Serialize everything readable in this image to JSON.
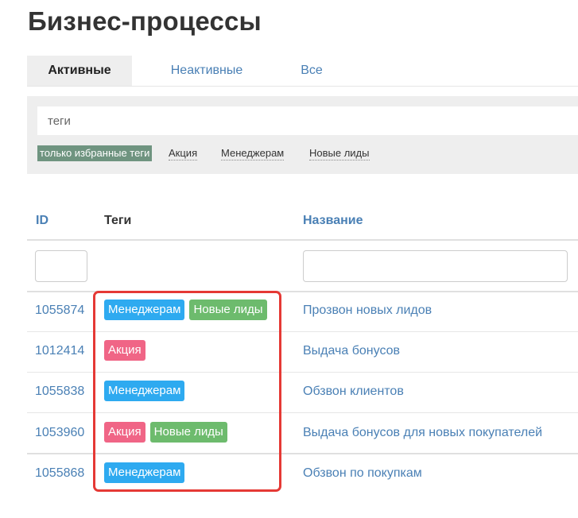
{
  "page": {
    "title": "Бизнес-процессы"
  },
  "tabs": [
    {
      "label": "Активные",
      "active": true
    },
    {
      "label": "Неактивные",
      "active": false
    },
    {
      "label": "Все",
      "active": false
    }
  ],
  "filter": {
    "tags_placeholder": "теги",
    "favorites_only_label": "только избранные теги",
    "quick_tags": [
      "Акция",
      "Менеджерам",
      "Новые лиды"
    ]
  },
  "table": {
    "headers": {
      "id": "ID",
      "tags": "Теги",
      "name": "Название"
    },
    "rows": [
      {
        "id": "1055874",
        "tags": [
          "Менеджерам",
          "Новые лиды"
        ],
        "name": "Прозвон новых лидов"
      },
      {
        "id": "1012414",
        "tags": [
          "Акция"
        ],
        "name": "Выдача бонусов"
      },
      {
        "id": "1055838",
        "tags": [
          "Менеджерам"
        ],
        "name": "Обзвон клиентов"
      },
      {
        "id": "1053960",
        "tags": [
          "Акция",
          "Новые лиды"
        ],
        "name": "Выдача бонусов для новых покупателей"
      },
      {
        "id": "1055868",
        "tags": [
          "Менеджерам"
        ],
        "name": "Обзвон по покупкам"
      }
    ]
  },
  "tag_colors": {
    "Менеджерам": "#2eaaf0",
    "Новые лиды": "#6dbb6d",
    "Акция": "#f06586"
  },
  "colors": {
    "link": "#4a80b5",
    "favorites_chip": "#6f9480",
    "highlight": "#e53935"
  }
}
